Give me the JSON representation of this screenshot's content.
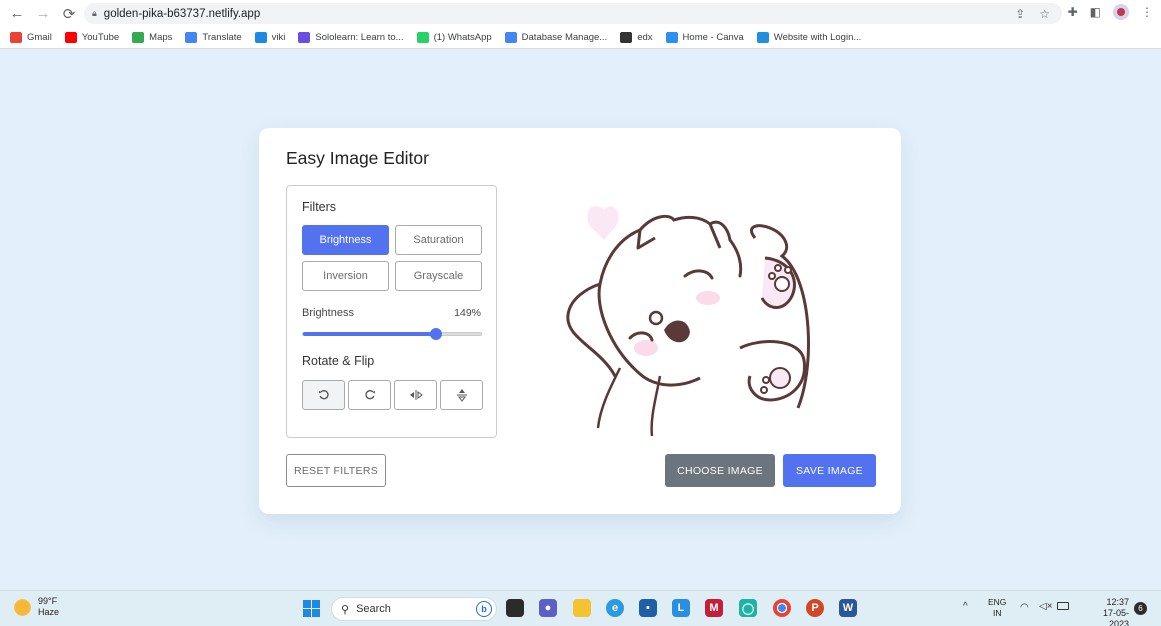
{
  "browser": {
    "url": "golden-pika-b63737.netlify.app",
    "bookmarks": [
      {
        "label": "Gmail",
        "icon": "gmail-icon",
        "color": "#ea4335"
      },
      {
        "label": "YouTube",
        "icon": "youtube-icon",
        "color": "#ff0000"
      },
      {
        "label": "Maps",
        "icon": "maps-icon",
        "color": "#34a853"
      },
      {
        "label": "Translate",
        "icon": "translate-icon",
        "color": "#4285f4"
      },
      {
        "label": "viki",
        "icon": "viki-icon",
        "color": "#1e88e5"
      },
      {
        "label": "Sololearn: Learn to...",
        "icon": "sololearn-icon",
        "color": "#6a4ce2"
      },
      {
        "label": "(1) WhatsApp",
        "icon": "whatsapp-icon",
        "color": "#25d366"
      },
      {
        "label": "Database Manage...",
        "icon": "g-icon",
        "color": "#4285f4"
      },
      {
        "label": "edx",
        "icon": "edx-icon",
        "color": "#333333"
      },
      {
        "label": "Home - Canva",
        "icon": "canva-icon",
        "color": "#2c8ff2"
      },
      {
        "label": "Website with Login...",
        "icon": "website-icon",
        "color": "#1f8fe0"
      }
    ]
  },
  "editor": {
    "title": "Easy Image Editor",
    "filters_title": "Filters",
    "filters": [
      {
        "label": "Brightness",
        "active": true
      },
      {
        "label": "Saturation",
        "active": false
      },
      {
        "label": "Inversion",
        "active": false
      },
      {
        "label": "Grayscale",
        "active": false
      }
    ],
    "slider": {
      "label": "Brightness",
      "value_text": "149%",
      "value": 149,
      "max": 200
    },
    "rotate_title": "Rotate & Flip",
    "rotate_buttons": [
      "rotate-left-icon",
      "rotate-right-icon",
      "flip-horizontal-icon",
      "flip-vertical-icon"
    ],
    "reset_label": "RESET FILTERS",
    "choose_label": "CHOOSE IMAGE",
    "save_label": "SAVE IMAGE",
    "accent_color": "#5372f0",
    "secondary_color": "#6c757d"
  },
  "taskbar": {
    "weather_temp": "99°F",
    "weather_desc": "Haze",
    "search_placeholder": "Search",
    "lang_top": "ENG",
    "lang_bottom": "IN",
    "time": "12:37",
    "date": "17-05-2023",
    "notification_count": "6"
  }
}
